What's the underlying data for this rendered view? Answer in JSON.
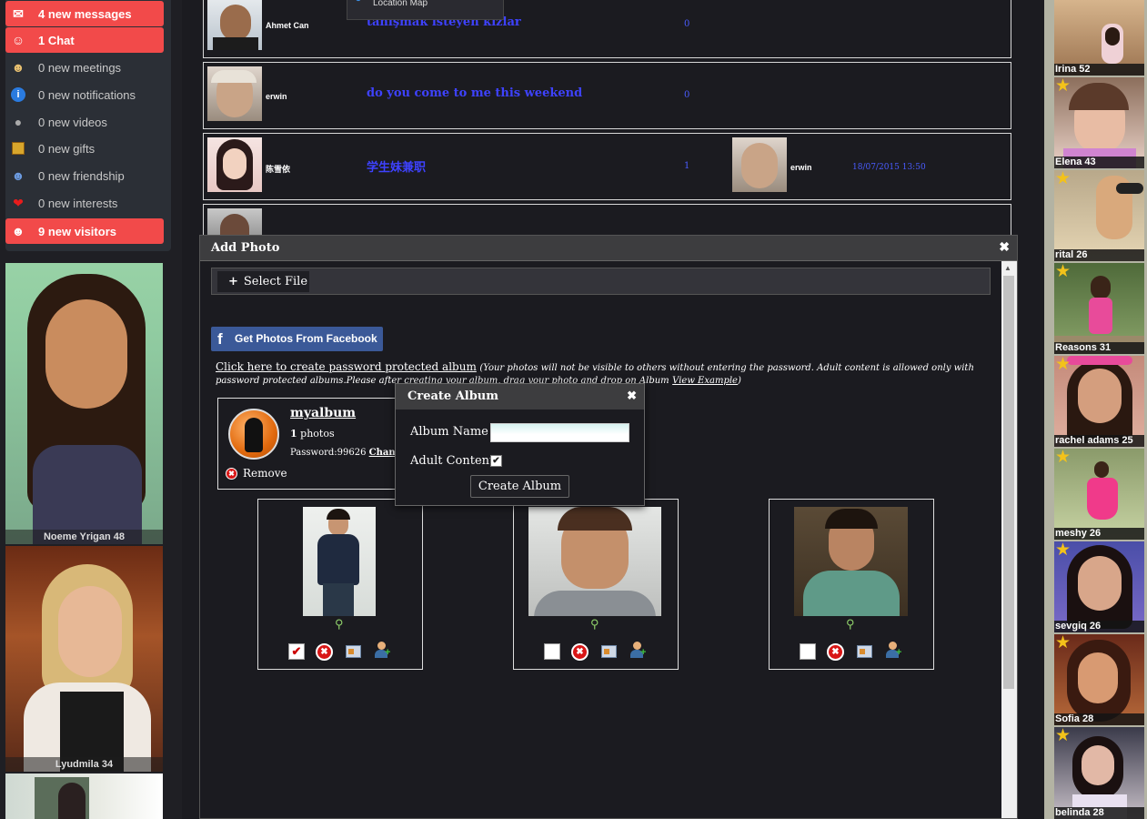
{
  "notifications": [
    {
      "label": "4 new messages",
      "icon": "envelope-icon",
      "highlight": true
    },
    {
      "label": "1 Chat",
      "icon": "chat-icon",
      "highlight": true
    },
    {
      "label": "0 new meetings",
      "icon": "meeting-icon",
      "highlight": false
    },
    {
      "label": "0 new notifications",
      "icon": "info-icon",
      "highlight": false
    },
    {
      "label": "0 new videos",
      "icon": "video-icon",
      "highlight": false
    },
    {
      "label": "0 new gifts",
      "icon": "gift-icon",
      "highlight": false
    },
    {
      "label": "0 new friendship",
      "icon": "friendship-icon",
      "highlight": false
    },
    {
      "label": "0 new interests",
      "icon": "heart-icon",
      "highlight": false
    },
    {
      "label": "9 new visitors",
      "icon": "visitor-icon",
      "highlight": true
    }
  ],
  "left_profiles": [
    {
      "caption": "Noeme Yrigan 48"
    },
    {
      "caption": "Lyudmila 34"
    },
    {
      "caption": ""
    }
  ],
  "tooltip": {
    "label": "Location Map",
    "icon": "globe-icon"
  },
  "messages": [
    {
      "sender": "Ahmet Can",
      "subject": "tanışmak isteyen kızlar",
      "count": "0",
      "reply_name": "",
      "date": ""
    },
    {
      "sender": "erwin",
      "subject": "do you come to me this weekend",
      "count": "0",
      "reply_name": "",
      "date": ""
    },
    {
      "sender": "陈雪依",
      "subject": "学生妹兼职",
      "count": "1",
      "reply_name": "erwin",
      "date": "18/07/2015 13:50"
    },
    {
      "sender": "",
      "subject": "",
      "count": "",
      "reply_name": "",
      "date": ""
    }
  ],
  "add_photo": {
    "title": "Add Photo",
    "close": "✖",
    "select_file": "Select File",
    "facebook_button": "Get Photos From Facebook",
    "album_link": "Click here to create password protected album",
    "album_note": "(Your photos will not be visible to others without entering the password. Adult content is allowed only with password protected albums.Please after creating your album, drag your photo and drop on Album",
    "view_example": "View Example",
    "album_note_end": ")",
    "album": {
      "name": "myalbum",
      "photo_count": "1",
      "photos_label": "photos",
      "password_label": "Password:",
      "password": "99626",
      "change": "Change",
      "remove": "Remove"
    },
    "photos": [
      {
        "checked": true,
        "check_mark": "✔"
      },
      {
        "checked": false,
        "check_mark": ""
      },
      {
        "checked": false,
        "check_mark": ""
      }
    ]
  },
  "create_album": {
    "title": "Create Album",
    "close": "✖",
    "name_label": "Album Name",
    "name_value": "",
    "adult_label": "Adult Content",
    "adult_checked": true,
    "adult_mark": "✔",
    "submit": "Create Album"
  },
  "right_profiles": [
    {
      "caption": "Irina 52",
      "featured": false
    },
    {
      "caption": "Elena 43",
      "featured": true
    },
    {
      "caption": "rital 26",
      "featured": true
    },
    {
      "caption": "Reasons 31",
      "featured": true
    },
    {
      "caption": "rachel adams 25",
      "featured": true
    },
    {
      "caption": "meshy 26",
      "featured": true
    },
    {
      "caption": "sevgiq 26",
      "featured": true
    },
    {
      "caption": "Sofia 28",
      "featured": true
    },
    {
      "caption": "belinda 28",
      "featured": true
    }
  ],
  "colors": {
    "highlight": "#f24a4a",
    "link": "#3e42ff",
    "facebook": "#3b5998",
    "background": "#1b1b20"
  }
}
